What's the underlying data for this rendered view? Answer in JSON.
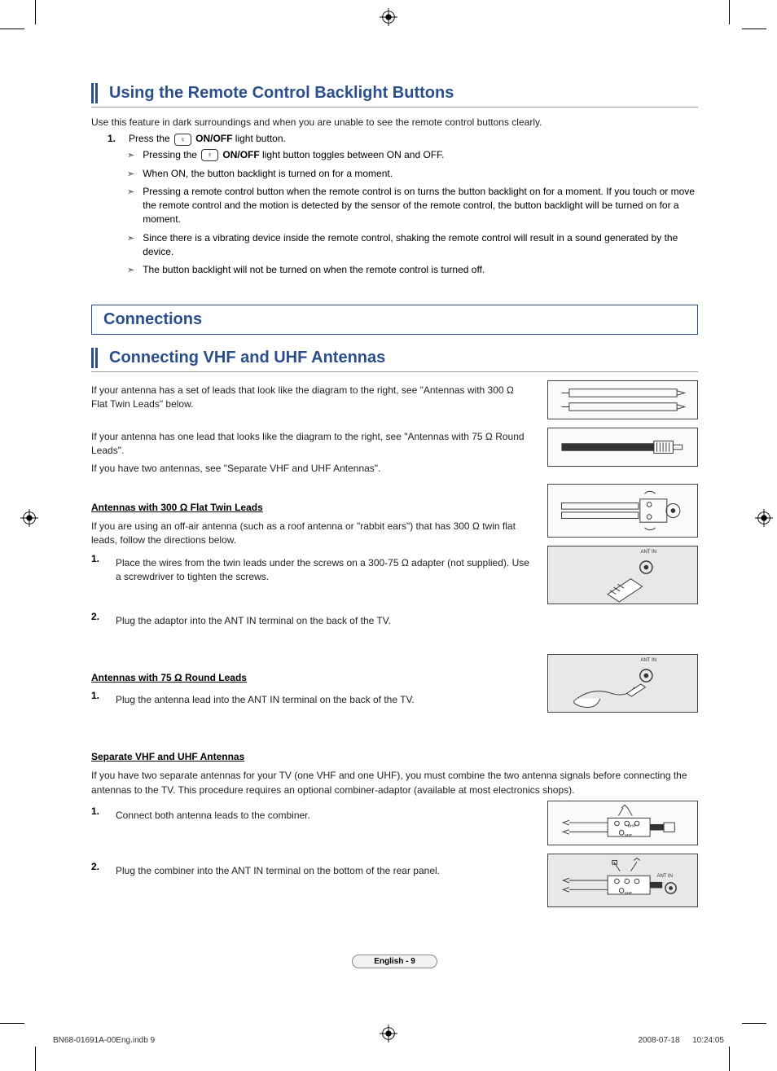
{
  "section1": {
    "title": "Using the Remote Control Backlight Buttons",
    "intro": "Use this feature in dark surroundings and when you are unable to see the remote control buttons clearly.",
    "step1_num": "1.",
    "step1_pre": "Press the ",
    "step1_btn": "ON/OFF",
    "step1_post": " light button.",
    "notes": {
      "n1_pre": "Pressing the ",
      "n1_btn": "ON/OFF",
      "n1_post": " light button toggles between ON and OFF.",
      "n2": "When ON, the button backlight is turned on for a moment.",
      "n3": "Pressing a remote control button when the remote control is on turns the button backlight on for a moment. If you touch or move the remote control and the motion is detected by the sensor of the remote control, the button backlight will be turned on for a moment.",
      "n4": "Since there is a vibrating device inside the remote control, shaking the remote control will result in a sound generated by the device.",
      "n5": "The button backlight will not be turned on when the remote control is turned off."
    }
  },
  "big_section": "Connections",
  "section2": {
    "title": "Connecting VHF and UHF Antennas",
    "p1": "If your antenna has a set of leads that look like the diagram to the right, see \"Antennas with 300 Ω Flat Twin Leads\" below.",
    "p2": "If your antenna has one lead that looks like the diagram to the right, see \"Antennas with 75 Ω Round Leads\".",
    "p3": "If you have two antennas, see \"Separate VHF and UHF Antennas\".",
    "sub1": {
      "title": "Antennas with 300 Ω Flat Twin Leads",
      "intro": "If you are using an off-air antenna (such as a roof antenna or \"rabbit ears\") that has 300 Ω twin flat leads, follow the directions below.",
      "s1n": "1.",
      "s1": "Place the wires from the twin leads under the screws on a 300-75 Ω adapter (not supplied). Use a screwdriver to tighten the screws.",
      "s2n": "2.",
      "s2": "Plug the adaptor into the ANT IN terminal on the back of the TV."
    },
    "sub2": {
      "title": "Antennas with 75 Ω Round Leads",
      "s1n": "1.",
      "s1": "Plug the antenna lead into the ANT IN terminal on the back of the TV."
    },
    "sub3": {
      "title": "Separate VHF and UHF Antennas",
      "intro": "If you have two separate antennas for your TV (one VHF and one UHF), you must combine the two antenna signals before connecting the antennas to the TV. This procedure requires an optional combiner-adaptor (available at most electronics shops).",
      "s1n": "1.",
      "s1": "Connect both antenna leads to the combiner.",
      "s2n": "2.",
      "s2": "Plug the combiner into the ANT IN terminal on the bottom of the rear panel."
    }
  },
  "diagram_labels": {
    "ant_in": "ANT IN",
    "uhf": "UHF",
    "vhf": "VHF"
  },
  "page_label": "English - 9",
  "footer_left": "BN68-01691A-00Eng.indb   9",
  "footer_right": "2008-07-18      10:24:05"
}
